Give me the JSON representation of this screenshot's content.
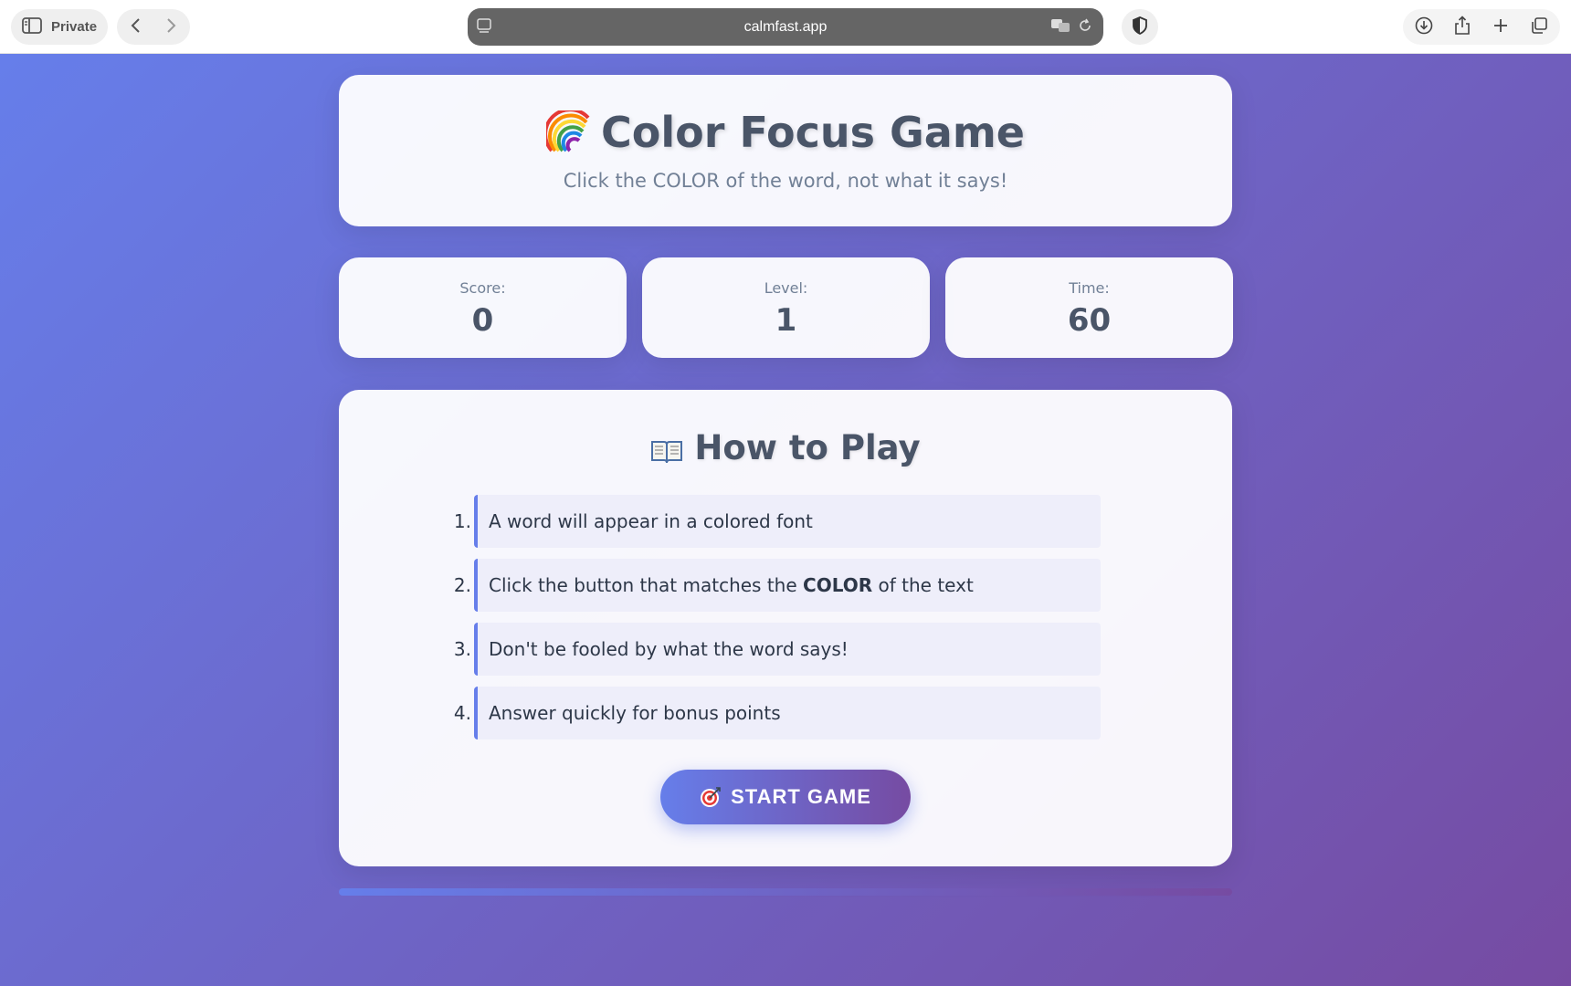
{
  "browser": {
    "private_label": "Private",
    "url": "calmfast.app"
  },
  "game": {
    "title": "Color Focus Game",
    "title_icon": "rainbow-icon",
    "subtitle": "Click the COLOR of the word, not what it says!"
  },
  "stats": {
    "score_label": "Score:",
    "score_value": "0",
    "level_label": "Level:",
    "level_value": "1",
    "time_label": "Time:",
    "time_value": "60"
  },
  "how_to_play": {
    "title": "How to Play",
    "title_icon": "open-book-icon",
    "steps": [
      {
        "num": "1.",
        "text_before": "A word will appear in a colored font",
        "bold": "",
        "text_after": ""
      },
      {
        "num": "2.",
        "text_before": "Click the button that matches the ",
        "bold": "COLOR",
        "text_after": " of the text"
      },
      {
        "num": "3.",
        "text_before": "Don't be fooled by what the word says!",
        "bold": "",
        "text_after": ""
      },
      {
        "num": "4.",
        "text_before": "Answer quickly for bonus points",
        "bold": "",
        "text_after": ""
      }
    ]
  },
  "start_button": {
    "label": "START GAME",
    "icon": "target-icon"
  },
  "progress": {
    "fraction": 1.0
  },
  "colors": {
    "gradient_start": "#667eea",
    "gradient_end": "#764ba2",
    "heading": "#4a5568",
    "muted": "#718096"
  }
}
